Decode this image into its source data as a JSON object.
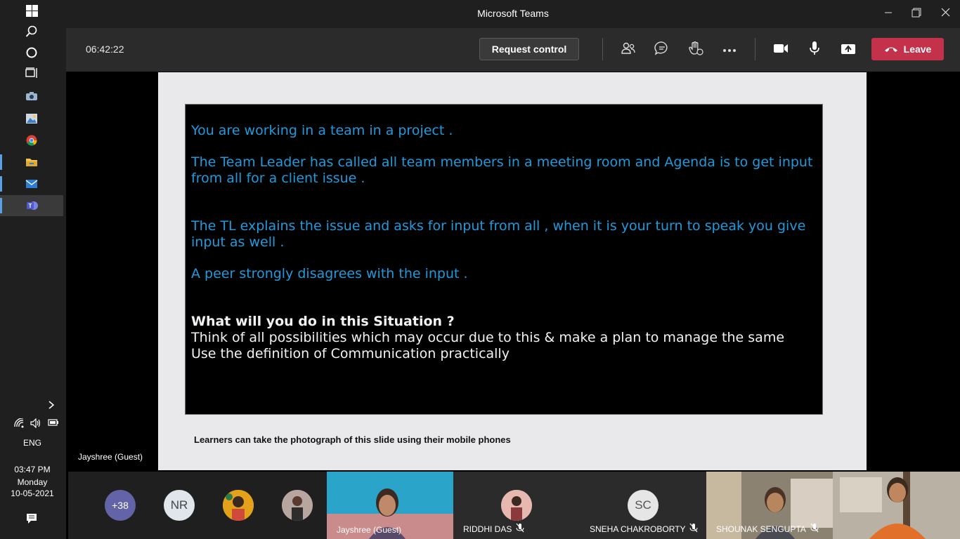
{
  "window": {
    "title": "Microsoft Teams"
  },
  "taskbar": {
    "tray": {
      "language": "ENG",
      "time": "03:47 PM",
      "day": "Monday",
      "date": "10-05-2021"
    }
  },
  "meeting": {
    "timer": "06:42:22",
    "request_control_label": "Request control",
    "leave_label": "Leave"
  },
  "slide": {
    "lines_blue": [
      "You are working in a team in a project .",
      "The Team Leader has called all team members in a meeting room and Agenda is to get input from all for a client issue .",
      "The TL explains the issue and asks for input from all , when it is your turn to speak you give input as well .",
      "A peer strongly disagrees with the input ."
    ],
    "question": "What will you do in this Situation ?",
    "lines_white": [
      "Think of all possibilities which may occur due to this & make a plan to manage the same",
      "Use the definition of Communication practically"
    ],
    "note": "Learners can take the photograph of this slide using their mobile phones"
  },
  "presenter": {
    "name": "Jayshree (Guest)"
  },
  "participants": {
    "overflow_count": "+38",
    "initials_1": "NR",
    "tiles": [
      {
        "name": "Jayshree (Guest)"
      },
      {
        "name": "RIDDHI DAS"
      },
      {
        "name": "SNEHA CHAKROBORTY",
        "initials": "SC"
      },
      {
        "name": "SHOUNAK SENGUPTA"
      }
    ]
  },
  "colors": {
    "leave": "#c4314b",
    "slide_blue": "#1e9bdc",
    "teams_purple": "#6264a7"
  }
}
